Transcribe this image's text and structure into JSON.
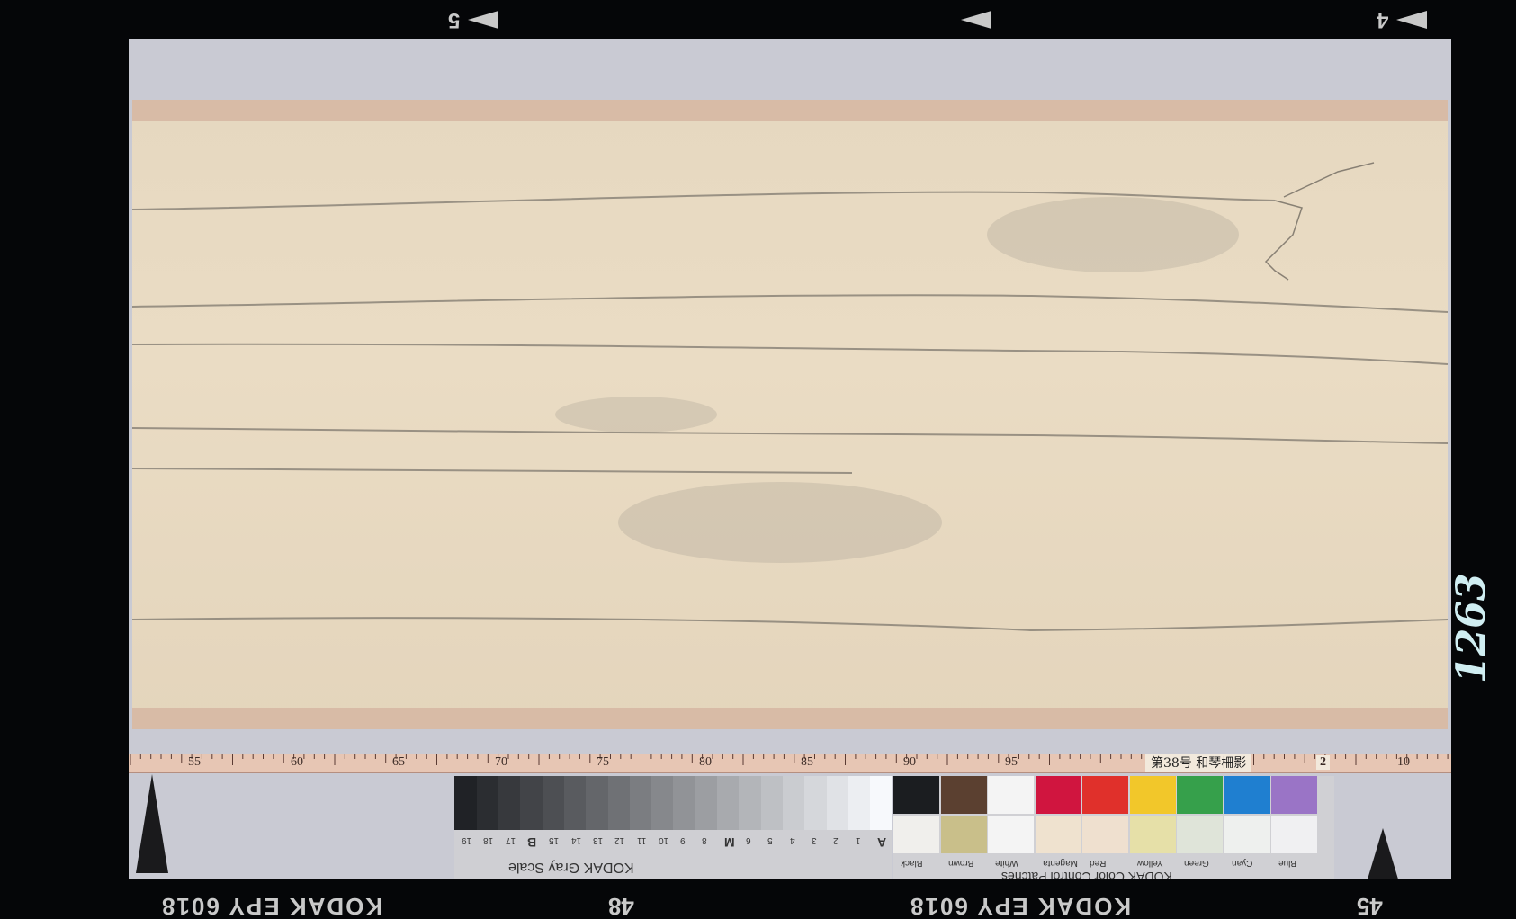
{
  "film": {
    "top_numbers": [
      "5",
      "4"
    ],
    "bottom_edge_text": [
      "KODAK EPY 6018",
      "48",
      "KODAK EPY 6018",
      "45"
    ],
    "side_handwriting": "1263"
  },
  "ruler": {
    "numbers": [
      "55",
      "60",
      "65",
      "70",
      "75",
      "80",
      "85",
      "90",
      "95",
      "2",
      "10"
    ],
    "label": "第38号 和琴柵影"
  },
  "gray_scale": {
    "title": "KODAK Gray Scale",
    "steps": [
      "A",
      "1",
      "2",
      "3",
      "4",
      "5",
      "6",
      "M",
      "8",
      "9",
      "10",
      "11",
      "12",
      "13",
      "14",
      "15",
      "B",
      "17",
      "18",
      "19"
    ]
  },
  "color_patches": {
    "title": "KODAK Color Control Patches",
    "names": [
      "Black",
      "Brown",
      "White",
      "Magenta",
      "Red",
      "Yellow",
      "Green",
      "Cyan",
      "Blue"
    ],
    "top_colors": [
      "#1b1d20",
      "#5b4030",
      "#f4f4f4",
      "#d0153f",
      "#e0302b",
      "#f2c72a",
      "#36a04b",
      "#1f7fd0",
      "#9a74c6"
    ],
    "bottom_colors": [
      "#f0efec",
      "#c9bf8a",
      "#f4f4f4",
      "#efe2cf",
      "#efe0cf",
      "#e6e0a8",
      "#dfe4d9",
      "#eef0ee",
      "#f0f0f2"
    ]
  }
}
